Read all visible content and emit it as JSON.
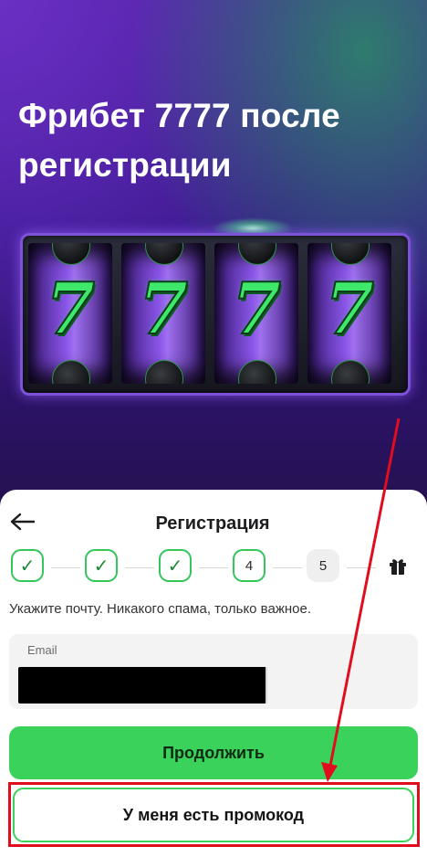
{
  "hero": {
    "title": "Фрибет 7777 после регистрации",
    "slot_symbols": [
      "7",
      "7",
      "7",
      "7"
    ]
  },
  "registration": {
    "back_icon": "arrow-left-icon",
    "title": "Регистрация",
    "steps": [
      {
        "state": "done",
        "label": "✓"
      },
      {
        "state": "done",
        "label": "✓"
      },
      {
        "state": "done",
        "label": "✓"
      },
      {
        "state": "active",
        "label": "4"
      },
      {
        "state": "todo",
        "label": "5"
      }
    ],
    "final_step_icon": "gift-icon",
    "hint": "Укажите почту. Никакого спама, только важное.",
    "email": {
      "label": "Email",
      "value": ""
    },
    "continue_label": "Продолжить",
    "promo_label": "У меня есть промокод"
  },
  "colors": {
    "accent_green": "#3bd25c",
    "annotation_red": "#e00d1f",
    "hero_purple": "#4a1f9c"
  }
}
